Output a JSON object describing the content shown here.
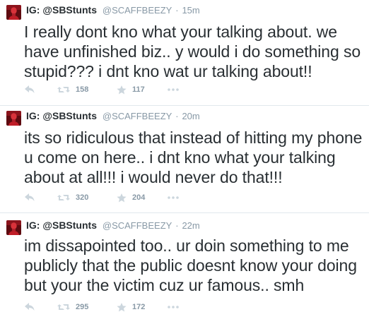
{
  "tweets": [
    {
      "fullname": "IG: @SBStunts",
      "username": "@SCAFFBEEZY",
      "separator": "·",
      "time": "15m",
      "text": "I really dont kno what your talking about. we have unfinished biz.. y would i do something so stupid??? i dnt kno wat ur talking about!!",
      "retweets": "158",
      "favorites": "117"
    },
    {
      "fullname": "IG: @SBStunts",
      "username": "@SCAFFBEEZY",
      "separator": "·",
      "time": "20m",
      "text": "its so ridiculous that instead of hitting my phone u come on here.. i dnt kno what your talking about at all!!! i would never do that!!!",
      "retweets": "320",
      "favorites": "204"
    },
    {
      "fullname": "IG: @SBStunts",
      "username": "@SCAFFBEEZY",
      "separator": "·",
      "time": "22m",
      "text": "im dissapointed too.. ur doin something to me publicly that the public doesnt know your doing but your the victim cuz ur famous.. smh",
      "retweets": "295",
      "favorites": "172"
    }
  ],
  "icons": {
    "reply": "reply-icon",
    "retweet": "retweet-icon",
    "favorite": "star-icon",
    "more": "more-dots-icon"
  },
  "colors": {
    "text": "#292f33",
    "muted": "#8899a6",
    "icon": "#ccd6dd",
    "divider": "#e1e8ed",
    "avatar_bg": "#7a1016"
  }
}
